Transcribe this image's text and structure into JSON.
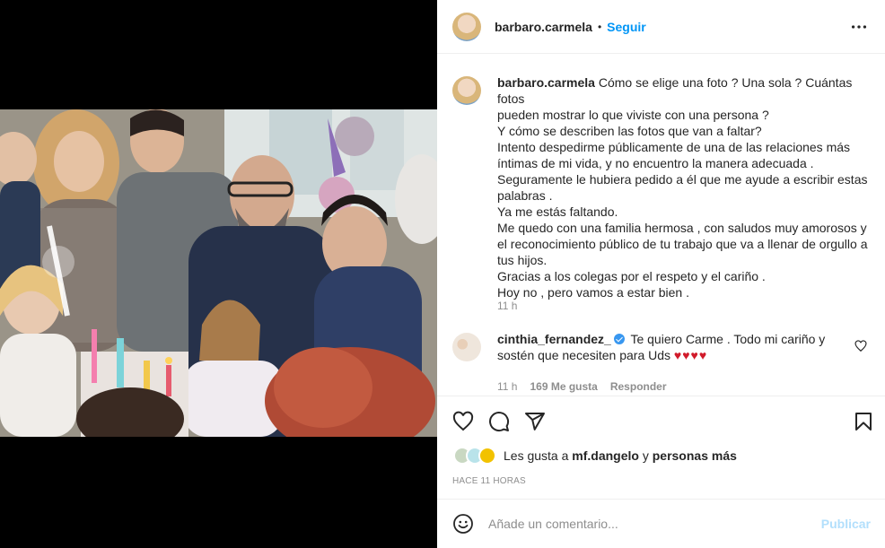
{
  "post": {
    "username": "barbaro.carmela",
    "separator": "•",
    "follow_label": "Seguir",
    "more_icon": "more-horizontal-icon"
  },
  "caption": {
    "username": "barbaro.carmela",
    "lines": [
      "Cómo se elige una foto ? Una sola ? Cuántas fotos",
      "pueden mostrar lo que viviste con una persona ?",
      "Y cómo se describen las fotos que van a faltar?",
      "Intento despedirme públicamente de una de las relaciones más",
      "íntimas de mi vida, y no encuentro la manera adecuada .",
      "Seguramente le hubiera pedido a él que me ayude a escribir estas",
      "palabras .",
      "Ya me estás faltando.",
      "Me quedo con una familia hermosa , con saludos muy amorosos y",
      "el reconocimiento público de tu trabajo que va a llenar de orgullo a",
      "tus hijos.",
      "Gracias a los colegas por el respeto y el cariño .",
      "Hoy no , pero vamos a estar bien ."
    ],
    "time": "11 h"
  },
  "comment": {
    "username": "cinthia_fernandez_",
    "text": "Te quiero Carme . Todo mi cariño y",
    "text2": "sostén que necesiten para Uds",
    "hearts": "♥♥♥♥",
    "time": "11 h",
    "likes": "169 Me gusta",
    "reply_label": "Responder"
  },
  "actions": {
    "like_icon": "heart-icon",
    "comment_icon": "comment-icon",
    "share_icon": "send-icon",
    "save_icon": "bookmark-icon"
  },
  "likes": {
    "prefix": "Les gusta a",
    "user": "mf.dangelo",
    "connector": "y",
    "suffix": "personas más"
  },
  "posted_ago": "HACE 11 HORAS",
  "add_comment": {
    "placeholder": "Añade un comentario...",
    "publish_label": "Publicar"
  },
  "colors": {
    "accent": "#0095f6",
    "publish_disabled": "#b2dffc",
    "muted": "#8e8e8e",
    "heart_red": "#d11a2a"
  }
}
